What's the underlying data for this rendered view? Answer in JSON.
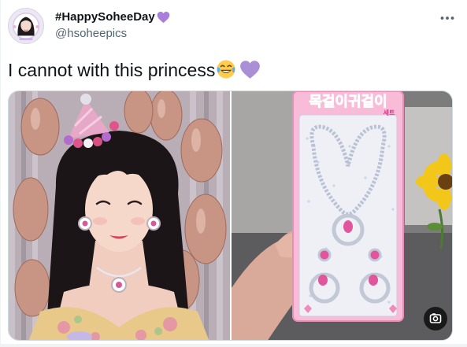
{
  "tweet": {
    "display_name": "#HappySoheeDay",
    "handle": "@hsoheepics",
    "text": "I cannot with this princess"
  },
  "packaging": {
    "title": "목걸이귀걸이",
    "subtitle": "세트"
  },
  "icons": {
    "name_heart": "purple-heart-icon",
    "more": "more-options-icon",
    "laugh_emoji": "tears-of-joy-emoji",
    "text_heart": "purple-heart-emoji",
    "media_badge": "image-view-icon"
  },
  "colors": {
    "text_primary": "#0f1419",
    "text_secondary": "#536471",
    "purple_heart": "#a87fdb",
    "border": "#cfd9de"
  }
}
